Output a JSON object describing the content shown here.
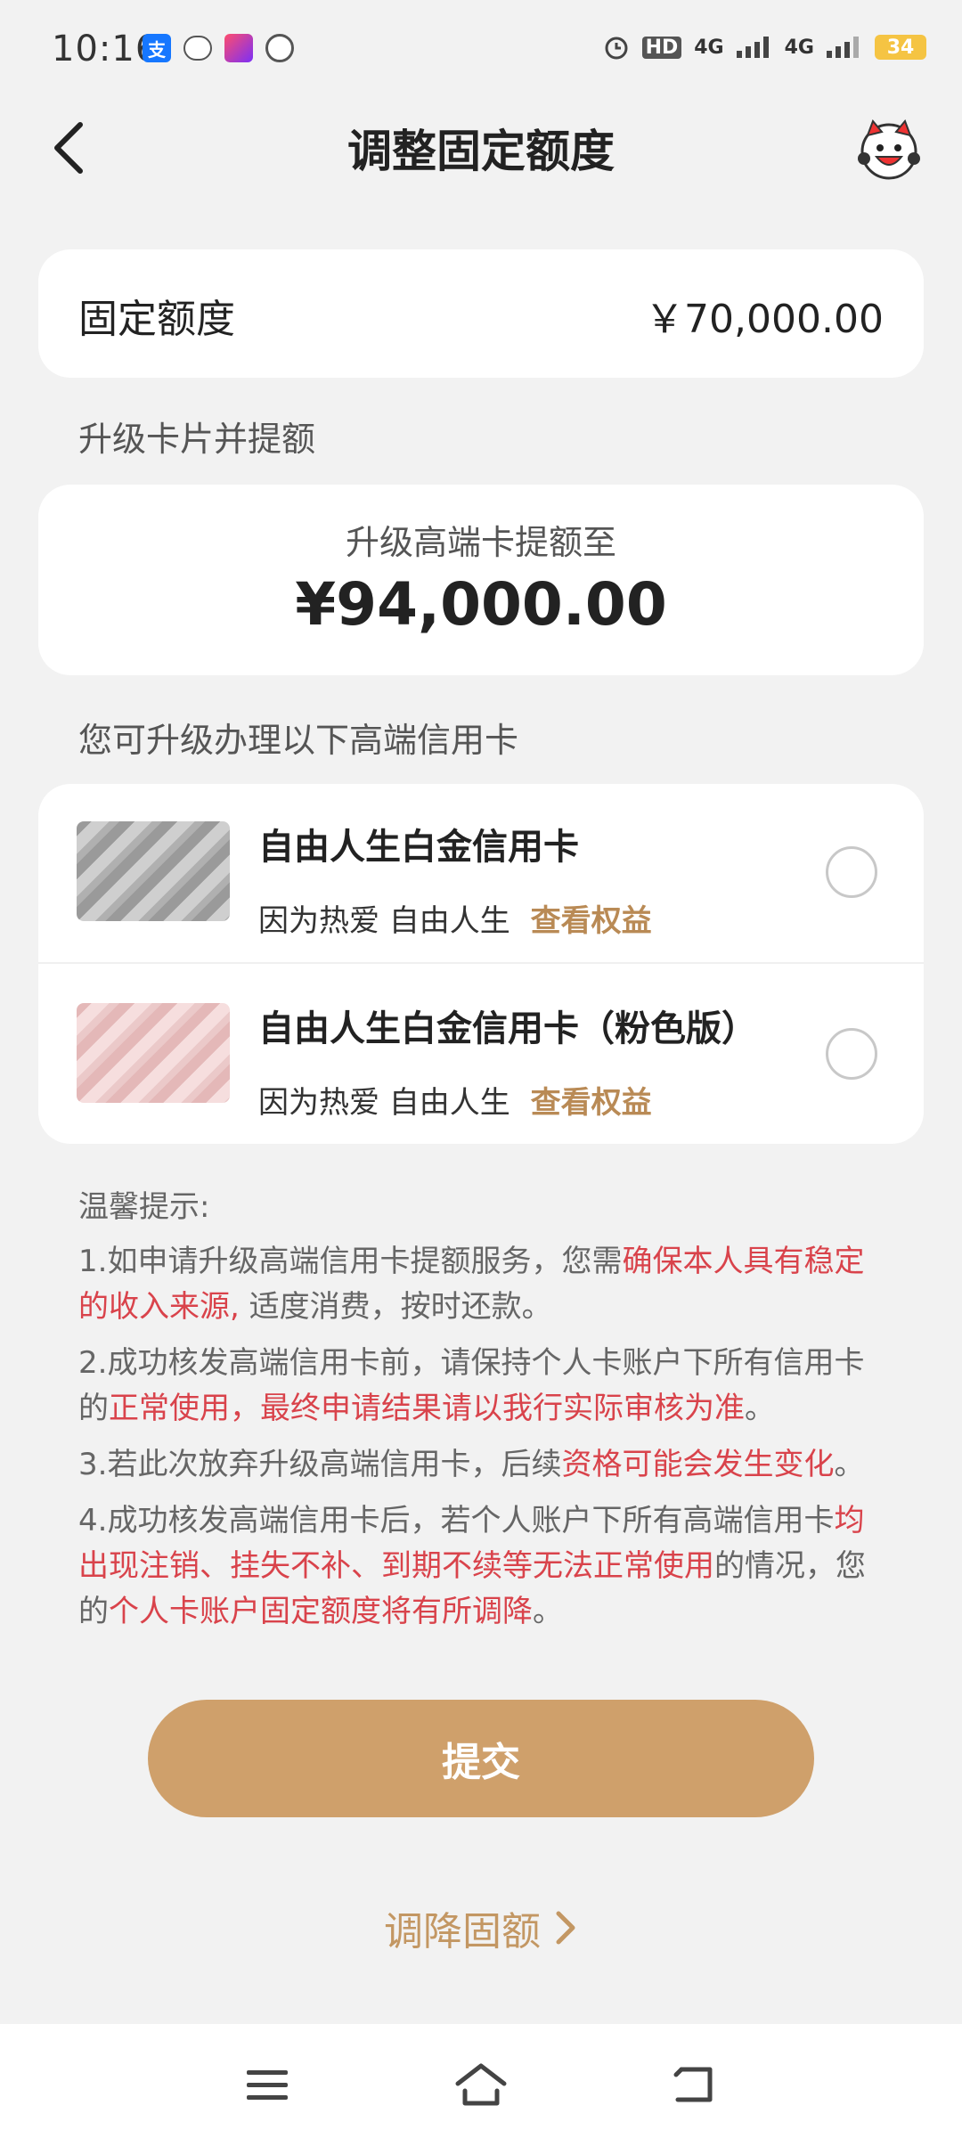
{
  "status_bar": {
    "time": "10:16",
    "battery": "34",
    "network_1": "4G",
    "network_2": "4G",
    "hd": "HD"
  },
  "header": {
    "title": "调整固定额度"
  },
  "fixed_limit": {
    "label": "固定额度",
    "value": "￥70,000.00"
  },
  "upgrade_section": {
    "title": "升级卡片并提额",
    "subtitle": "升级高端卡提额至",
    "amount": "¥94,000.00"
  },
  "cards_section": {
    "title": "您可升级办理以下高端信用卡",
    "cards": [
      {
        "name": "自由人生白金信用卡",
        "desc": "因为热爱 自由人生",
        "link": "查看权益"
      },
      {
        "name": "自由人生白金信用卡（粉色版）",
        "desc": "因为热爱 自由人生",
        "link": "查看权益"
      }
    ]
  },
  "tips": {
    "title": "温馨提示:",
    "t1_a": "1.如申请升级高端信用卡提额服务，您需",
    "t1_b": "确保本人具有稳定的收入来源,",
    "t1_c": " 适度消费，按时还款。",
    "t2_a": "2.成功核发高端信用卡前，请保持个人卡账户下所有信用卡的",
    "t2_b": "正常使用，最终申请结果请以我行实际审核为准",
    "t2_c": "。",
    "t3_a": "3.若此次放弃升级高端信用卡，后续",
    "t3_b": "资格可能会发生变化",
    "t3_c": "。",
    "t4_a": "4.成功核发高端信用卡后，若个人账户下所有高端信用卡",
    "t4_b": "均出现注销、挂失不补、到期不续等无法正常使用",
    "t4_c": "的情况，您的",
    "t4_d": "个人卡账户固定额度将有所调降",
    "t4_e": "。"
  },
  "actions": {
    "submit": "提交",
    "reduce": "调降固额"
  },
  "colors": {
    "accent": "#cfa06b",
    "link": "#b98a55",
    "warning": "#d9434b"
  }
}
